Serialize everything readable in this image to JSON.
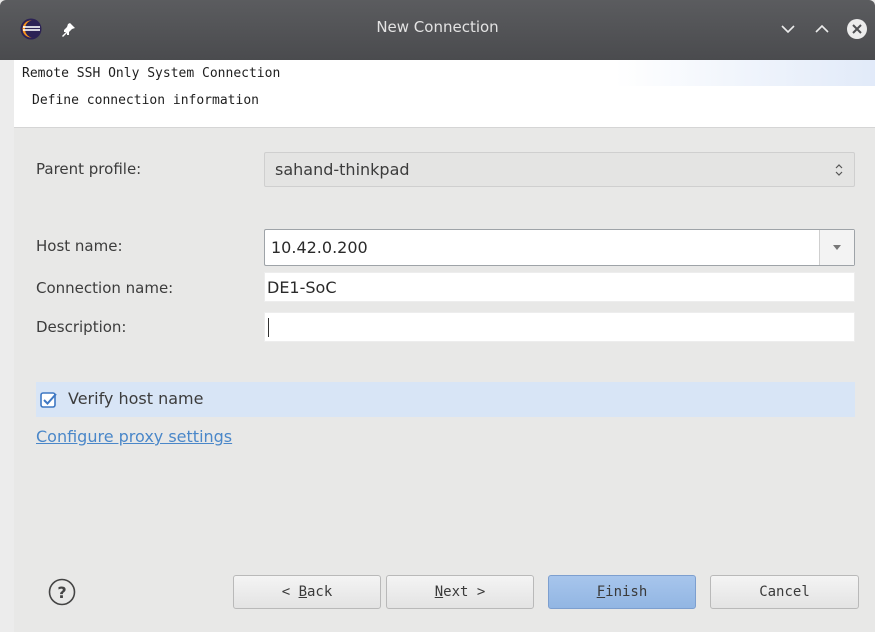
{
  "window": {
    "title": "New Connection"
  },
  "header": {
    "title": "Remote SSH Only System Connection",
    "description": "Define connection information"
  },
  "form": {
    "parent_profile": {
      "label": "Parent profile:",
      "value": "sahand-thinkpad"
    },
    "host_name": {
      "label": "Host name:",
      "value": "10.42.0.200"
    },
    "connection_name": {
      "label": "Connection name:",
      "value": "DE1-SoC"
    },
    "description": {
      "label": "Description:",
      "value": ""
    },
    "verify_host": {
      "label": "Verify host name",
      "checked": true
    },
    "proxy_link": "Configure proxy settings"
  },
  "buttons": {
    "back": {
      "prefix": "< ",
      "mnemonic": "B",
      "rest": "ack"
    },
    "next": {
      "mnemonic": "N",
      "rest": "ext >"
    },
    "finish": {
      "mnemonic": "F",
      "rest": "inish"
    },
    "cancel": "Cancel"
  },
  "colors": {
    "titlebar": "#4f5053",
    "accent": "#4a87c9",
    "finish_button": "#9bbde8",
    "verify_row_highlight": "#d8e5f6"
  },
  "icons": {
    "app": "eclipse-icon",
    "pin": "pin-icon",
    "minimize": "chevron-down-icon",
    "maximize": "chevron-up-icon",
    "close": "close-icon",
    "help": "help-icon"
  }
}
